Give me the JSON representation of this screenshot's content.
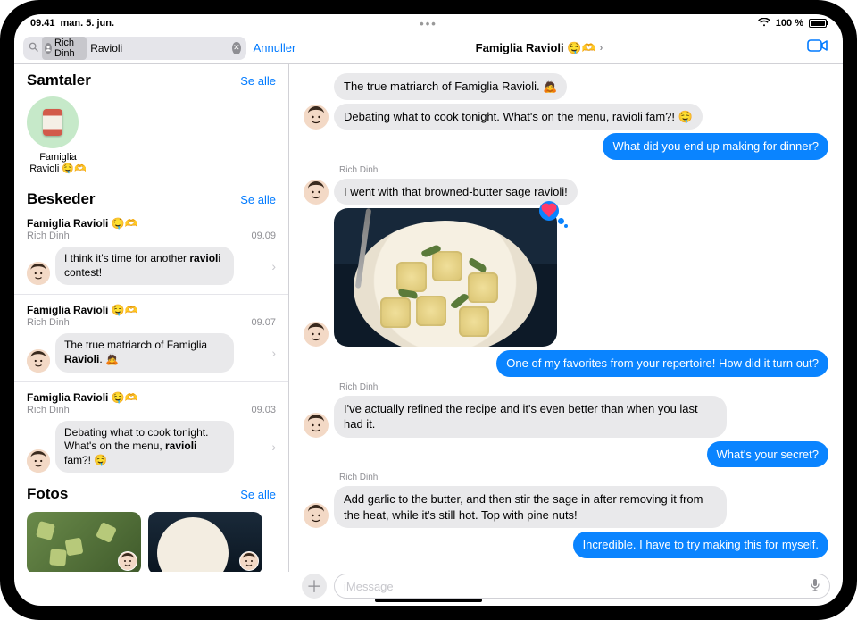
{
  "status": {
    "time": "09.41",
    "date": "man. 5. jun.",
    "battery_pct": "100 %"
  },
  "navbar": {
    "search_token": "Rich Dinh",
    "search_query": "Ravioli",
    "cancel": "Annuller",
    "title": "Famiglia Ravioli 🤤🫶"
  },
  "sidebar": {
    "section_samtaler": "Samtaler",
    "section_beskeder": "Beskeder",
    "section_fotos": "Fotos",
    "see_all": "Se alle",
    "convo": {
      "line1": "Famiglia",
      "line2": "Ravioli 🤤🫶"
    },
    "messages": [
      {
        "group": "Famiglia Ravioli 🤤🫶",
        "sender": "Rich Dinh",
        "time": "09.09",
        "html": "I think it's time for another <b>ravioli</b> contest!"
      },
      {
        "group": "Famiglia Ravioli 🤤🫶",
        "sender": "Rich Dinh",
        "time": "09.07",
        "html": "The true matriarch of Famiglia <b>Ravioli</b>. 🙇"
      },
      {
        "group": "Famiglia Ravioli 🤤🫶",
        "sender": "Rich Dinh",
        "time": "09.03",
        "html": "Debating what to cook tonight. What's on the menu, <b>ravioli</b> fam?! 🤤"
      }
    ]
  },
  "chat": {
    "sender_name": "Rich Dinh",
    "lines": {
      "r1": "The true matriarch of Famiglia Ravioli. 🙇",
      "r2": "Debating what to cook tonight. What's on the menu, ravioli fam?! 🤤",
      "s1": "What did you end up making for dinner?",
      "r3": "I went with that browned-butter sage ravioli!",
      "s2": "One of my favorites from your repertoire! How did it turn out?",
      "r4": "I've actually refined the recipe and it's even better than when you last had it.",
      "s3": "What's your secret?",
      "r5": "Add garlic to the butter, and then stir the sage in after removing it from the heat, while it's still hot. Top with pine nuts!",
      "s4": "Incredible. I have to try making this for myself."
    }
  },
  "input": {
    "placeholder": "iMessage"
  }
}
